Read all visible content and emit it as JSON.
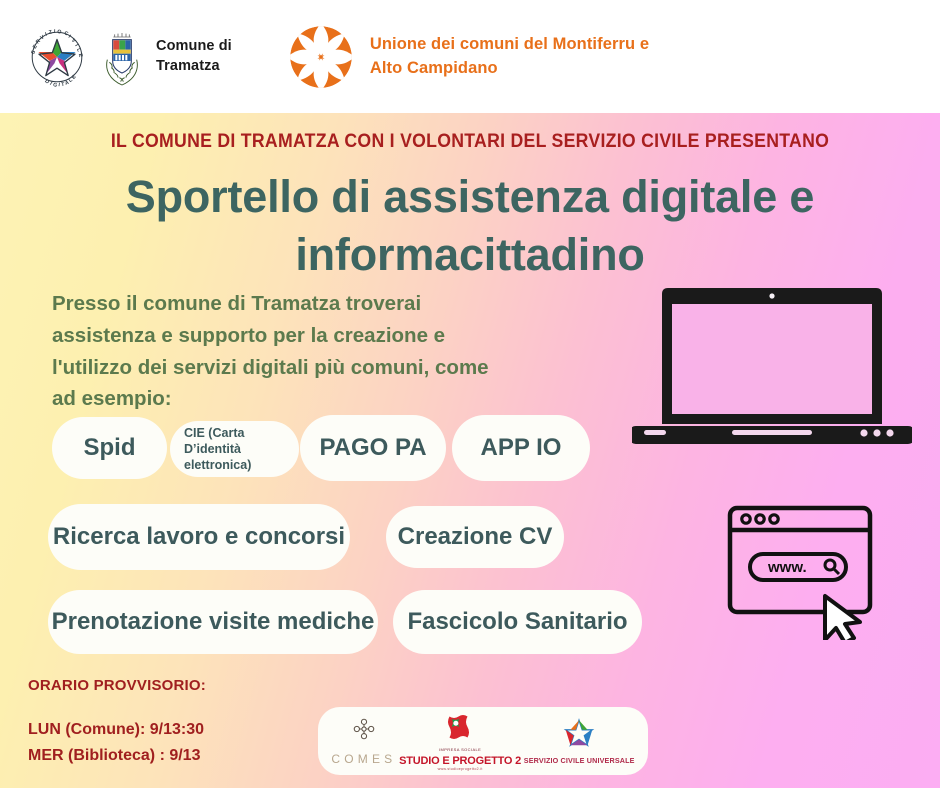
{
  "header": {
    "logo_scd_name": "servizio-civile-digitale-logo",
    "comune_label": "Comune di\nTramatza",
    "comune_line1": "Comune di",
    "comune_line2": "Tramatza",
    "stemma_name": "stemma-comune-tramatza",
    "unione_logo_name": "unione-comuni-logo",
    "unione_line1": "Unione dei comuni del Montiferru e",
    "unione_line2": "Alto Campidano"
  },
  "poster": {
    "kicker": "IL COMUNE DI TRAMATZA CON I VOLONTARI DEL SERVIZIO CIVILE PRESENTANO",
    "title_line1": "Sportello di assistenza digitale e",
    "title_line2": "informacittadino",
    "intro_line1": "Presso il comune di Tramatza troverai",
    "intro_line2": "assistenza e supporto per la creazione e",
    "intro_line3": "l'utilizzo dei servizi digitali più comuni, come",
    "intro_line4": "ad esempio:"
  },
  "services": [
    {
      "label": "Spid",
      "size": "big"
    },
    {
      "label": "CIE (Carta D’identità elettronica)",
      "size": "small"
    },
    {
      "label": "PAGO PA",
      "size": "big"
    },
    {
      "label": "APP IO",
      "size": "big"
    },
    {
      "label": "Ricerca lavoro e concorsi",
      "size": "big"
    },
    {
      "label": "Creazione CV",
      "size": "big"
    },
    {
      "label": "Prenotazione visite mediche",
      "size": "big"
    },
    {
      "label": "Fascicolo Sanitario",
      "size": "big"
    }
  ],
  "schedule": {
    "heading": "ORARIO PROVVISORIO:",
    "line1": "LUN (Comune): 9/13:30",
    "line2": "MER (Biblioteca) : 9/13"
  },
  "partners": [
    {
      "name": "comes-logo",
      "word": "COMES"
    },
    {
      "name": "studio-e-progetto-2-logo",
      "top": "IMPRESA SOCIALE",
      "word": "STUDIO E PROGETTO 2",
      "sub": "www.studioeprogetto2.it"
    },
    {
      "name": "servizio-civile-universale-logo",
      "word": "SERVIZIO CIVILE UNIVERSALE"
    }
  ],
  "illustrations": {
    "laptop_name": "laptop-illustration",
    "browser_name": "browser-window-illustration",
    "browser_url_text": "www.",
    "cursor_name": "mouse-cursor-icon",
    "search_icon_name": "search-icon"
  },
  "colors": {
    "kicker": "#a81f1f",
    "title": "#3d6561",
    "intro": "#5c7a4d",
    "pill_text": "#3d5a5c",
    "pill_bg": "#fdfdf8",
    "schedule": "#a01f1f",
    "unione_orange": "#e8701a",
    "gradient_start": "#fdf3b4",
    "gradient_end": "#fcadf3"
  }
}
